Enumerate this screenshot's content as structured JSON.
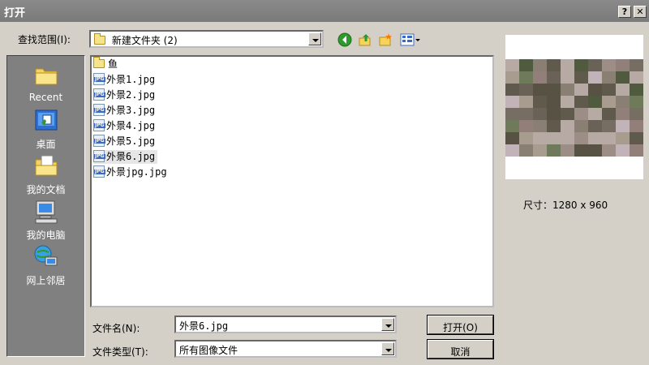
{
  "window": {
    "title": "打开",
    "help_btn": "?",
    "close_btn": "✕"
  },
  "lookin": {
    "label": "查找范围(I):",
    "value": "新建文件夹 (2)"
  },
  "toolbar": {
    "icons": [
      "back-icon",
      "up-folder-icon",
      "new-folder-icon",
      "view-menu-icon"
    ]
  },
  "places": [
    {
      "label": "Recent",
      "icon": "recent-icon"
    },
    {
      "label": "桌面",
      "icon": "desktop-icon"
    },
    {
      "label": "我的文档",
      "icon": "my-documents-icon"
    },
    {
      "label": "我的电脑",
      "icon": "my-computer-icon"
    },
    {
      "label": "网上邻居",
      "icon": "network-icon"
    }
  ],
  "files": [
    {
      "name": "鱼",
      "type": "folder"
    },
    {
      "name": "外景1.jpg",
      "type": "jpg"
    },
    {
      "name": "外景2.jpg",
      "type": "jpg"
    },
    {
      "name": "外景3.jpg",
      "type": "jpg"
    },
    {
      "name": "外景4.jpg",
      "type": "jpg"
    },
    {
      "name": "外景5.jpg",
      "type": "jpg"
    },
    {
      "name": "外景6.jpg",
      "type": "jpg",
      "selected": true
    },
    {
      "name": "外景jpg.jpg",
      "type": "jpg"
    }
  ],
  "jpg_badge": "JPG",
  "filename": {
    "label": "文件名(N):",
    "value": "外景6.jpg"
  },
  "filetype": {
    "label": "文件类型(T):",
    "value": "所有图像文件"
  },
  "buttons": {
    "open": "打开(O)",
    "cancel": "取消"
  },
  "preview": {
    "size_text": "尺寸：1280 x 960"
  }
}
